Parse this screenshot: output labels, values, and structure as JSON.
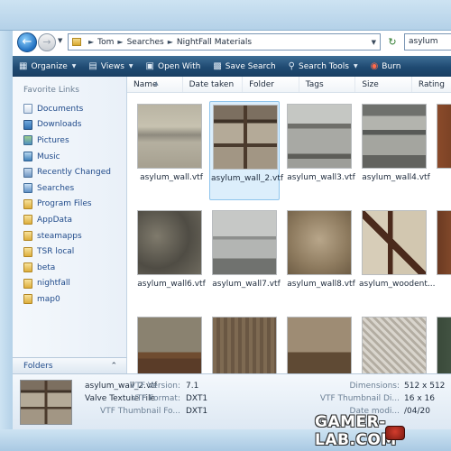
{
  "navigation": {
    "breadcrumbs": [
      "Tom",
      "Searches",
      "NightFall Materials"
    ],
    "search_value": "asylum"
  },
  "commands": [
    {
      "label": "Organize",
      "icon": "organize-icon",
      "has_dropdown": true
    },
    {
      "label": "Views",
      "icon": "views-icon",
      "has_dropdown": true
    },
    {
      "label": "Open With",
      "icon": "open-with-icon",
      "has_dropdown": false
    },
    {
      "label": "Save Search",
      "icon": "save-search-icon",
      "has_dropdown": false
    },
    {
      "label": "Search Tools",
      "icon": "search-tools-icon",
      "has_dropdown": true
    },
    {
      "label": "Burn",
      "icon": "burn-icon",
      "has_dropdown": false
    }
  ],
  "sidebar": {
    "heading": "Favorite Links",
    "items": [
      {
        "label": "Documents",
        "icon": "documents-icon"
      },
      {
        "label": "Downloads",
        "icon": "downloads-icon"
      },
      {
        "label": "Pictures",
        "icon": "pictures-icon"
      },
      {
        "label": "Music",
        "icon": "music-icon"
      },
      {
        "label": "Recently Changed",
        "icon": "recently-changed-icon"
      },
      {
        "label": "Searches",
        "icon": "searches-icon"
      },
      {
        "label": "Program Files",
        "icon": "folder-icon"
      },
      {
        "label": "AppData",
        "icon": "folder-icon"
      },
      {
        "label": "steamapps",
        "icon": "folder-icon"
      },
      {
        "label": "TSR local",
        "icon": "folder-icon"
      },
      {
        "label": "beta",
        "icon": "folder-icon"
      },
      {
        "label": "nightfall",
        "icon": "folder-icon"
      },
      {
        "label": "map0",
        "icon": "folder-icon"
      }
    ],
    "folders_label": "Folders"
  },
  "columns": [
    "Name",
    "Date taken",
    "Folder",
    "Tags",
    "Size",
    "Rating"
  ],
  "files": [
    {
      "name": "asylum_wall.vtf",
      "selected": false
    },
    {
      "name": "asylum_wall_2.vtf",
      "selected": true
    },
    {
      "name": "asylum_wall3.vtf",
      "selected": false
    },
    {
      "name": "asylum_wall4.vtf",
      "selected": false
    },
    {
      "name": "",
      "selected": false
    },
    {
      "name": "asylum_wall6.vtf",
      "selected": false
    },
    {
      "name": "asylum_wall7.vtf",
      "selected": false
    },
    {
      "name": "asylum_wall8.vtf",
      "selected": false
    },
    {
      "name": "asylum_woodent...",
      "selected": false
    },
    {
      "name": "",
      "selected": false
    },
    {
      "name": "",
      "selected": false
    },
    {
      "name": "",
      "selected": false
    },
    {
      "name": "",
      "selected": false
    },
    {
      "name": "",
      "selected": false
    },
    {
      "name": "",
      "selected": false
    }
  ],
  "details": {
    "name": "asylum_wall_2.vtf",
    "type": "Valve Texture File",
    "props_left": [
      {
        "label": "VTF Version:",
        "value": "7.1"
      },
      {
        "label": "VTF Format:",
        "value": "DXT1"
      },
      {
        "label": "VTF Thumbnail Fo...",
        "value": "DXT1"
      }
    ],
    "props_right": [
      {
        "label": "Dimensions:",
        "value": "512 x 512"
      },
      {
        "label": "VTF Thumbnail Di...",
        "value": "16 x 16"
      },
      {
        "label": "Date modi...",
        "value": "/04/20"
      }
    ]
  },
  "watermark": "GAMER-LAB.COM"
}
